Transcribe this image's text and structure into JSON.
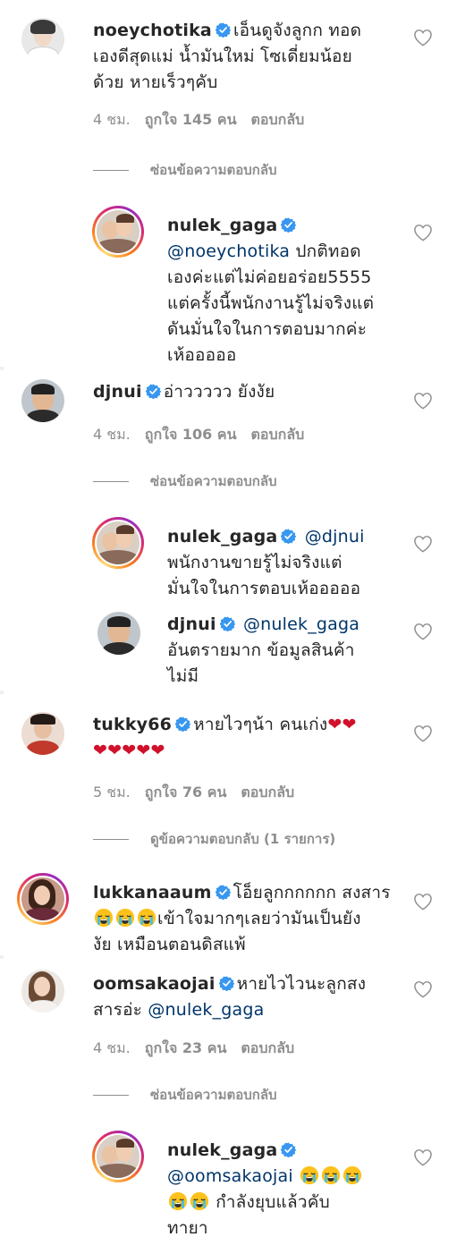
{
  "comments": [
    {
      "user": "noeychotika",
      "avatar_icon": "woman-portrait",
      "text_lines": [
        "เอ็นดูจังลูกก ทอด",
        "เองดีสุดแม่ น้ำมันใหม่ โซเดี่ยมน้อย",
        "ด้วย หายเร็วๆคับ"
      ],
      "time": "4 ชม.",
      "likes": "ถูกใจ 145 คน",
      "reply": "ตอบกลับ",
      "toggle": "ซ่อนข้อความตอบกลับ"
    },
    {
      "user": "nulek_gaga",
      "avatar_icon": "two-people-portrait",
      "mention": "@noeychotika",
      "text_lines": [
        " ปกติทอด",
        "เองค่ะแต่ไม่ค่อยอร่อย5555",
        "แต่ครั้งนี้พนักงานรู้ไม่จริงแต่",
        "ดันมั่นใจในการตอบมากค่ะ",
        "เห้อออออ"
      ]
    },
    {
      "user": "djnui",
      "avatar_icon": "man-smiling-portrait",
      "text_lines": [
        "อ่าววววว ยังงัย"
      ],
      "time": "4 ชม.",
      "likes": "ถูกใจ 106 คน",
      "reply": "ตอบกลับ",
      "toggle": "ซ่อนข้อความตอบกลับ"
    },
    {
      "user": "nulek_gaga",
      "avatar_icon": "two-people-portrait",
      "mention": "@djnui",
      "text_lines": [
        "พนักงานขายรู้ไม่จริงแต่",
        "มั่นใจในการตอบเห้อออออ"
      ]
    },
    {
      "user": "djnui",
      "avatar_icon": "man-smiling-portrait",
      "mention": "@nulek_gaga",
      "text_lines": [
        "อันตรายมาก ข้อมูลสินค้า",
        "ไม่มี"
      ]
    },
    {
      "user": "tukky66",
      "avatar_icon": "woman-portrait",
      "text_lines": [
        "หายไวๆน้า คนเก่ง"
      ],
      "time": "5 ชม.",
      "likes": "ถูกใจ 76 คน",
      "reply": "ตอบกลับ",
      "toggle": "ดูข้อความตอบกลับ (1 รายการ)"
    },
    {
      "user": "lukkanaaum",
      "avatar_icon": "woman-portrait",
      "text_lines": [
        "โอ็ยลูกกกกกก สงสาร",
        "เข้าใจมากๆเลยว่ามันเป็นยัง",
        "งัย เหมือนตอนดิสแพ้"
      ]
    },
    {
      "user": "oomsakaojai",
      "avatar_icon": "woman-portrait",
      "text_lines": [
        "หายไวไวนะลูกสง",
        "สารอ่ะ"
      ],
      "mention": "@nulek_gaga",
      "time": "4 ชม.",
      "likes": "ถูกใจ 23 คน",
      "reply": "ตอบกลับ",
      "toggle": "ซ่อนข้อความตอบกลับ"
    },
    {
      "user": "nulek_gaga",
      "avatar_icon": "two-people-portrait",
      "mention": "@oomsakaojai",
      "text_lines": [
        "กำลังยุบแล้วคับ",
        "ทายา"
      ]
    }
  ],
  "icons": {
    "like": "heart-outline-icon",
    "verified": "verified-badge-icon",
    "emoji_heart": "red-heart-emoji",
    "emoji_sob": "loudly-crying-face-emoji"
  },
  "colors": {
    "verified": "#3897f0",
    "mention": "#003569",
    "meta": "#8e8e8e",
    "emoji_heart": "#d0112b"
  }
}
